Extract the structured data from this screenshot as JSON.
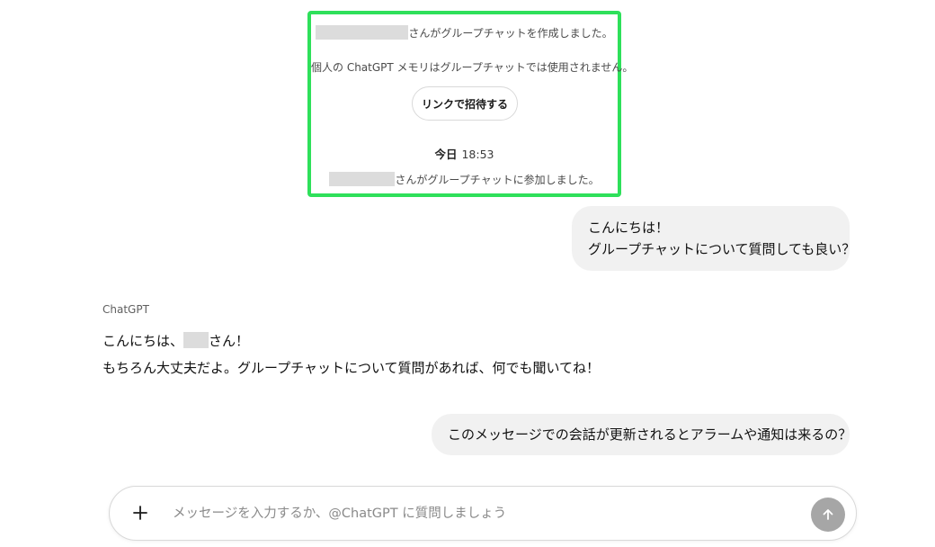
{
  "system": {
    "created_text": "さんがグループチャットを作成しました。",
    "memory_notice": "個人の ChatGPT メモリはグループチャットでは使用されません。",
    "invite_button": "リンクで招待する",
    "time_label_day": "今日",
    "time_label_time": "18:53",
    "joined_text": "さんがグループチャットに参加しました。"
  },
  "messages": {
    "user1_line1": "こんにちは！",
    "user1_line2": "グループチャットについて質問しても良い？",
    "assistant_name": "ChatGPT",
    "assistant_line1_prefix": "こんにちは、",
    "assistant_line1_suffix": "さん！",
    "assistant_line2": "もちろん大丈夫だよ。グループチャットについて質問があれば、何でも聞いてね！",
    "user2": "このメッセージでの会話が更新されるとアラームや通知は来るの？"
  },
  "composer": {
    "placeholder": "メッセージを入力するか、@ChatGPT に質問しましょう"
  },
  "colors": {
    "highlight_border": "#2ee05a",
    "bubble_bg": "#f1f1f1",
    "send_button_bg": "#a6a6a6"
  },
  "icons": {
    "plus": "plus-icon",
    "send": "arrow-up-icon"
  }
}
